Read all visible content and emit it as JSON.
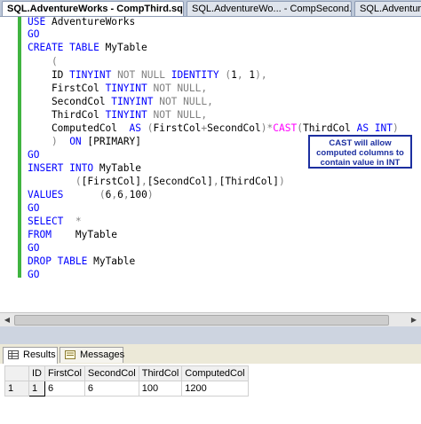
{
  "tabs": [
    {
      "label": "SQL.AdventureWorks - CompThird.sql",
      "active": true,
      "close": "×"
    },
    {
      "label": "SQL.AdventureWo... - CompSecond.sql",
      "active": false
    },
    {
      "label": "SQL.Adventure",
      "active": false
    }
  ],
  "callout": "CAST will allow computed columns to contain value in INT",
  "results": {
    "tabs": [
      {
        "label": "Results",
        "icon": "grid-icon"
      },
      {
        "label": "Messages",
        "icon": "messages-icon"
      }
    ],
    "columns": [
      "ID",
      "FirstCol",
      "SecondCol",
      "ThirdCol",
      "ComputedCol"
    ],
    "rows": [
      {
        "rownum": "1",
        "cells": [
          "1",
          "6",
          "6",
          "100",
          "1200"
        ]
      }
    ]
  },
  "colors": {
    "keyword": "#0000ff",
    "operator": "#808080",
    "function": "#ff00ff",
    "gutter": "#40b440",
    "callout_border": "#1c2fa0"
  }
}
